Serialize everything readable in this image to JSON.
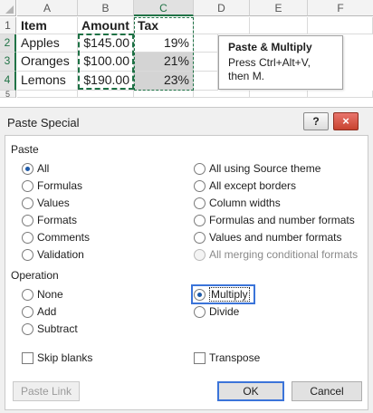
{
  "spreadsheet": {
    "columns": [
      "A",
      "B",
      "C",
      "D",
      "E",
      "F"
    ],
    "rows": [
      "1",
      "2",
      "3",
      "4",
      "5"
    ],
    "headers": {
      "item": "Item",
      "amount": "Amount",
      "tax": "Tax"
    },
    "data": [
      {
        "item": "Apples",
        "amount": "$145.00",
        "tax": "19%"
      },
      {
        "item": "Oranges",
        "amount": "$100.00",
        "tax": "21%"
      },
      {
        "item": "Lemons",
        "amount": "$190.00",
        "tax": "23%"
      }
    ],
    "comment": {
      "title": "Paste & Multiply",
      "line1": "Press Ctrl+Alt+V,",
      "line2": "then M."
    },
    "colors": {
      "selection_accent": "#217346",
      "shaded_cell": "#d4d4d4"
    }
  },
  "dialog": {
    "title": "Paste Special",
    "help_glyph": "?",
    "close_glyph": "×",
    "paste_section": "Paste",
    "paste_options_left": [
      "All",
      "Formulas",
      "Values",
      "Formats",
      "Comments",
      "Validation"
    ],
    "paste_options_right": [
      "All using Source theme",
      "All except borders",
      "Column widths",
      "Formulas and number formats",
      "Values and number formats",
      "All merging conditional formats"
    ],
    "selected_paste": "All",
    "operation_section": "Operation",
    "operation_options_left": [
      "None",
      "Add",
      "Subtract"
    ],
    "operation_options_right": [
      "Multiply",
      "Divide"
    ],
    "selected_operation": "Multiply",
    "skip_blanks": "Skip blanks",
    "transpose": "Transpose",
    "paste_link": "Paste Link",
    "ok": "OK",
    "cancel": "Cancel",
    "colors": {
      "focus": "#3b74d9",
      "radio_dot": "#1e5aa8"
    }
  }
}
